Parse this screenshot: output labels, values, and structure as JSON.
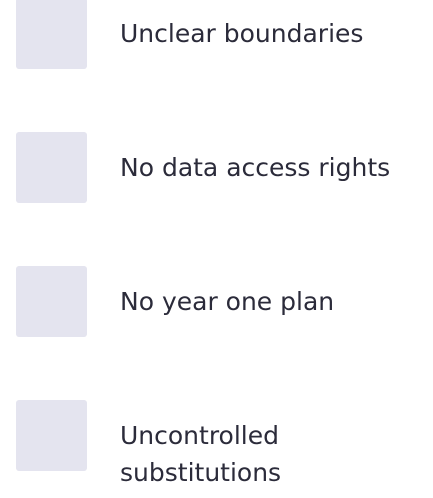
{
  "list": {
    "items": [
      {
        "label": "Unclear boundaries",
        "checked": false
      },
      {
        "label": "No data access rights",
        "checked": false
      },
      {
        "label": "No year one plan",
        "checked": false
      },
      {
        "label": "Uncontrolled substitutions",
        "checked": false
      }
    ]
  },
  "colors": {
    "box_fill": "#e4e4ef",
    "text": "#2b2b3a",
    "background": "#ffffff"
  }
}
